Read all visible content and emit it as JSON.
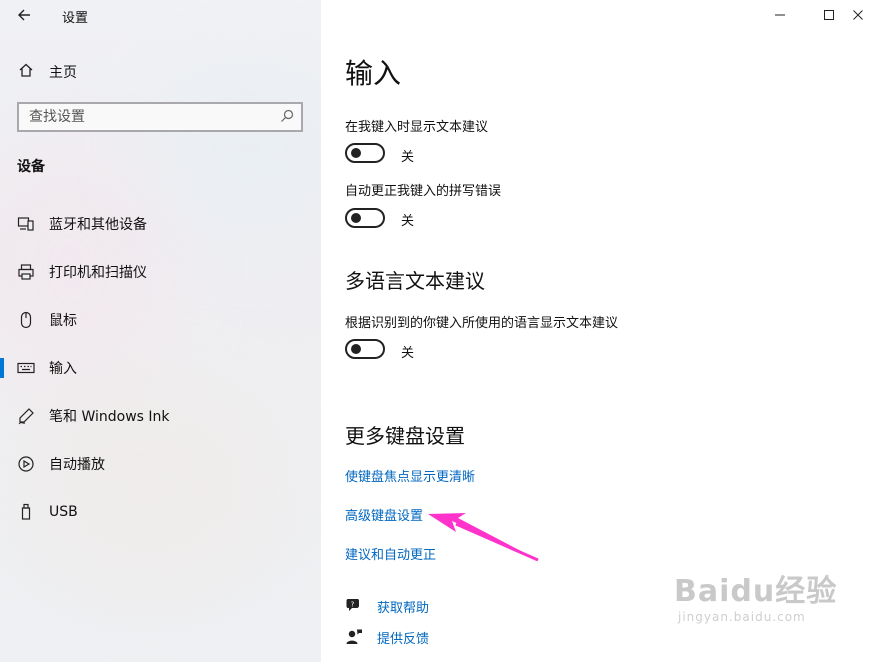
{
  "window": {
    "title": "设置",
    "back_icon": "back-arrow-icon",
    "controls": [
      "minimize-icon",
      "maximize-icon",
      "close-icon"
    ]
  },
  "sidebar": {
    "home": {
      "label": "主页",
      "icon": "home-icon"
    },
    "search": {
      "placeholder": "查找设置",
      "icon": "search-icon"
    },
    "section_title": "设备",
    "items": [
      {
        "label": "蓝牙和其他设备",
        "icon": "bluetooth-devices-icon",
        "selected": false
      },
      {
        "label": "打印机和扫描仪",
        "icon": "printer-icon",
        "selected": false
      },
      {
        "label": "鼠标",
        "icon": "mouse-icon",
        "selected": false
      },
      {
        "label": "输入",
        "icon": "keyboard-icon",
        "selected": true
      },
      {
        "label": "笔和 Windows Ink",
        "icon": "pen-icon",
        "selected": false
      },
      {
        "label": "自动播放",
        "icon": "autoplay-icon",
        "selected": false
      },
      {
        "label": "USB",
        "icon": "usb-icon",
        "selected": false
      }
    ]
  },
  "main": {
    "title": "输入",
    "typing_options": [
      {
        "label": "在我键入时显示文本建议",
        "state": "关",
        "on": false
      },
      {
        "label": "自动更正我键入的拼写错误",
        "state": "关",
        "on": false
      }
    ],
    "multilang": {
      "heading": "多语言文本建议",
      "label": "根据识别到的你键入所使用的语言显示文本建议",
      "state": "关",
      "on": false
    },
    "more_keyboard": {
      "heading": "更多键盘设置",
      "links": [
        "使键盘焦点显示更清晰",
        "高级键盘设置",
        "建议和自动更正"
      ]
    },
    "help": [
      {
        "label": "获取帮助",
        "icon": "help-chat-icon"
      },
      {
        "label": "提供反馈",
        "icon": "feedback-icon"
      }
    ]
  },
  "annotation": {
    "arrow_color": "#ff33cc",
    "points_to": "高级键盘设置"
  },
  "watermark": {
    "brand": "Baidu经验",
    "url": "jingyan.baidu.com"
  },
  "colors": {
    "accent": "#0078d4",
    "link": "#0067c0",
    "sidebar_bg": "#efeff2"
  }
}
